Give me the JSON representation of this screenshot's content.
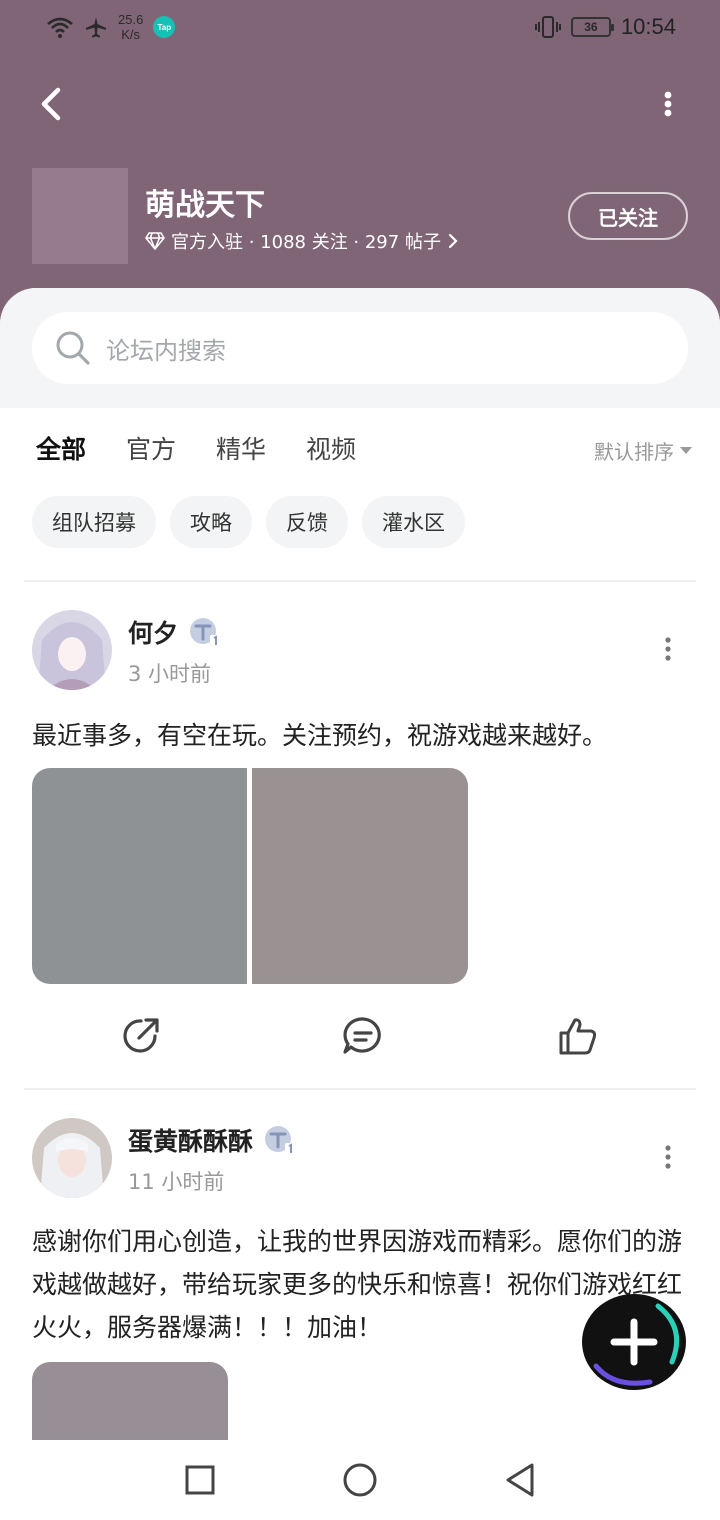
{
  "status_bar": {
    "net_speed_value": "25.6",
    "net_speed_unit": "K/s",
    "app_badge": "Tap",
    "battery": "36",
    "time": "10:54"
  },
  "forum": {
    "name": "萌战天下",
    "meta": "官方入驻 · 1088 关注 · 297 帖子",
    "follow_label": "已关注",
    "header_color": "#806577"
  },
  "search": {
    "placeholder": "论坛内搜索"
  },
  "tabs": [
    {
      "label": "全部",
      "active": true
    },
    {
      "label": "官方",
      "active": false
    },
    {
      "label": "精华",
      "active": false
    },
    {
      "label": "视频",
      "active": false
    }
  ],
  "sort_label": "默认排序",
  "chips": [
    "组队招募",
    "攻略",
    "反馈",
    "灌水区"
  ],
  "posts": [
    {
      "author": "何夕",
      "time": "3 小时前",
      "text": "最近事多，有空在玩。关注预约，祝游戏越来越好。"
    },
    {
      "author": "蛋黄酥酥酥",
      "time": "11 小时前",
      "text": "感谢你们用心创造，让我的世界因游戏而精彩。愿你们的游戏越做越好，带给玩家更多的快乐和惊喜！祝你们游戏红红火火，服务器爆满！！！加油！"
    }
  ],
  "accent_color": "#16c0b4"
}
